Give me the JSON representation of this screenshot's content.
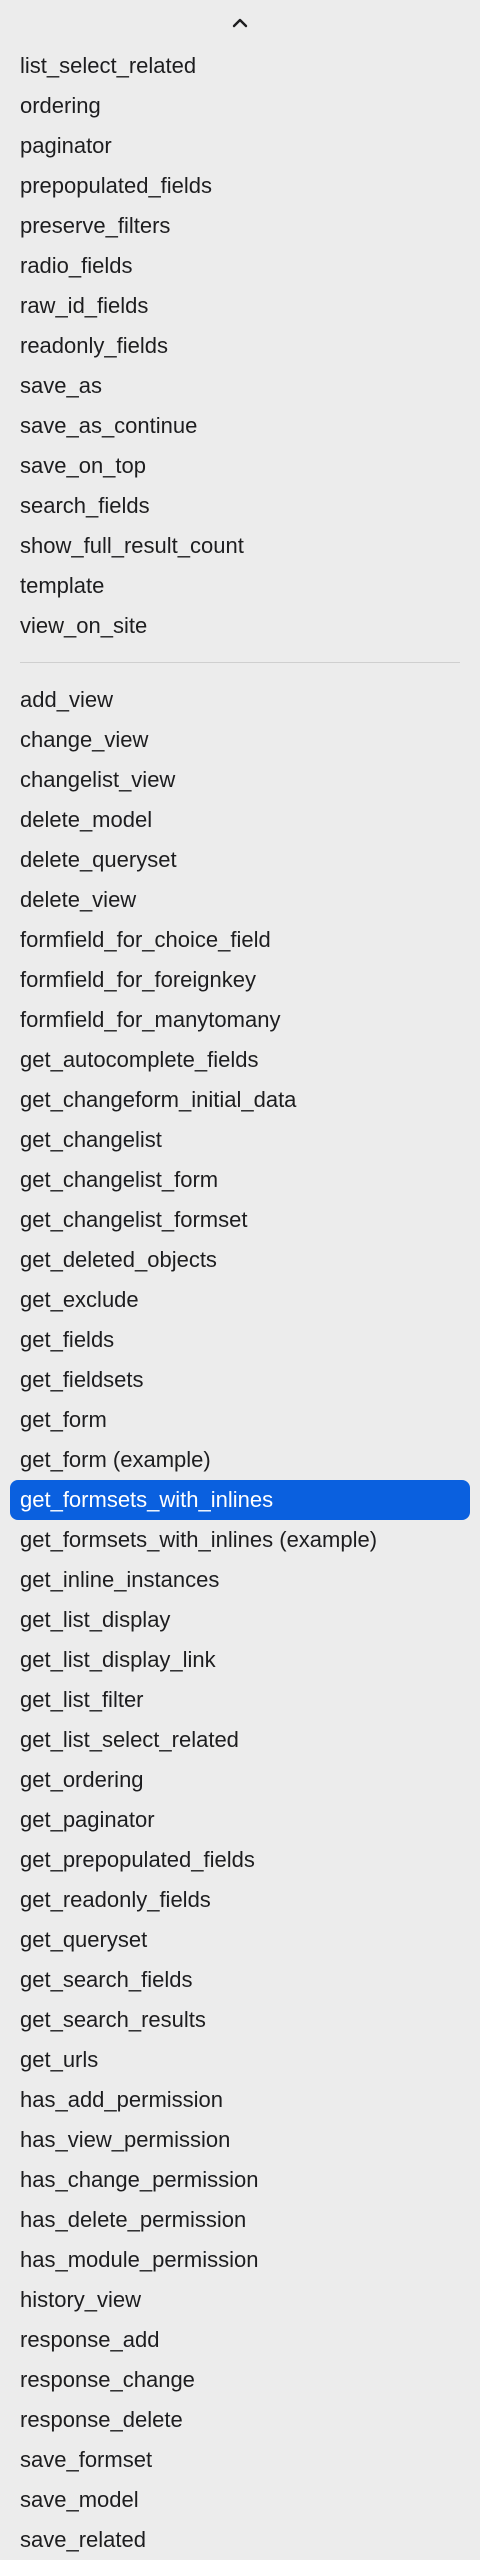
{
  "menu": {
    "scroll_up_icon": "chevron-up-icon",
    "selected_color": "#0a60df",
    "group1": [
      "list_select_related",
      "ordering",
      "paginator",
      "prepopulated_fields",
      "preserve_filters",
      "radio_fields",
      "raw_id_fields",
      "readonly_fields",
      "save_as",
      "save_as_continue",
      "save_on_top",
      "search_fields",
      "show_full_result_count",
      "template",
      "view_on_site"
    ],
    "group2": [
      "add_view",
      "change_view",
      "changelist_view",
      "delete_model",
      "delete_queryset",
      "delete_view",
      "formfield_for_choice_field",
      "formfield_for_foreignkey",
      "formfield_for_manytomany",
      "get_autocomplete_fields",
      "get_changeform_initial_data",
      "get_changelist",
      "get_changelist_form",
      "get_changelist_formset",
      "get_deleted_objects",
      "get_exclude",
      "get_fields",
      "get_fieldsets",
      "get_form",
      "get_form (example)",
      "get_formsets_with_inlines",
      "get_formsets_with_inlines (example)",
      "get_inline_instances",
      "get_list_display",
      "get_list_display_link",
      "get_list_filter",
      "get_list_select_related",
      "get_ordering",
      "get_paginator",
      "get_prepopulated_fields",
      "get_readonly_fields",
      "get_queryset",
      "get_search_fields",
      "get_search_results",
      "get_urls",
      "has_add_permission",
      "has_view_permission",
      "has_change_permission",
      "has_delete_permission",
      "has_module_permission",
      "history_view",
      "response_add",
      "response_change",
      "response_delete",
      "save_formset",
      "save_model",
      "save_related"
    ],
    "selected_item": "get_formsets_with_inlines"
  }
}
